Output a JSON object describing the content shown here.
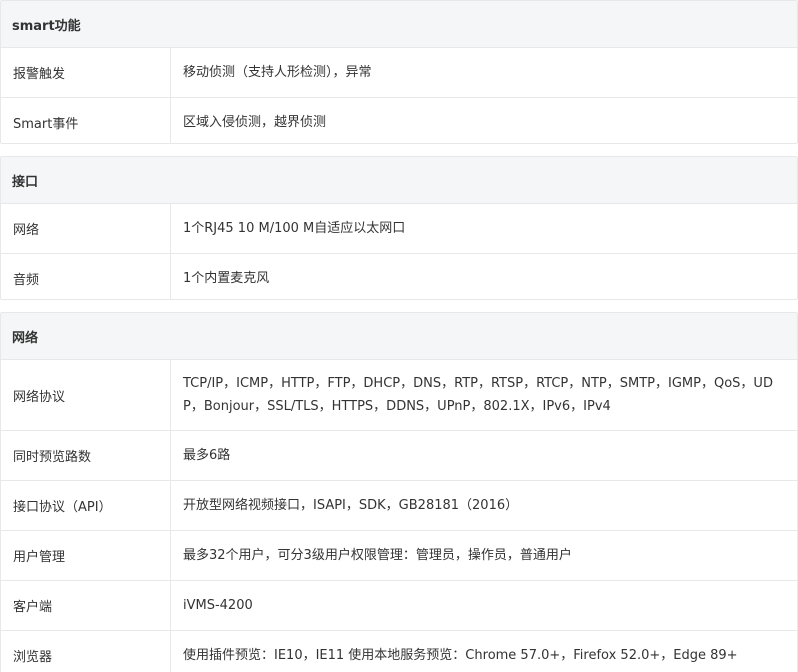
{
  "sections": [
    {
      "title": "smart功能",
      "rows": [
        {
          "label": "报警触发",
          "value": "移动侦测（支持人形检测），异常"
        },
        {
          "label": "Smart事件",
          "value": "区域入侵侦测，越界侦测"
        }
      ]
    },
    {
      "title": "接口",
      "rows": [
        {
          "label": "网络",
          "value": "1个RJ45 10 M/100 M自适应以太网口"
        },
        {
          "label": "音频",
          "value": "1个内置麦克风"
        }
      ]
    },
    {
      "title": "网络",
      "rows": [
        {
          "label": "网络协议",
          "value": "TCP/IP，ICMP，HTTP，FTP，DHCP，DNS，RTP，RTSP，RTCP，NTP，SMTP，IGMP，QoS，UDP，Bonjour，SSL/TLS，HTTPS，DDNS，UPnP，802.1X，IPv6，IPv4"
        },
        {
          "label": "同时预览路数",
          "value": "最多6路"
        },
        {
          "label": "接口协议（API）",
          "value": "开放型网络视频接口，ISAPI，SDK，GB28181（2016）"
        },
        {
          "label": "用户管理",
          "value": "最多32个用户，可分3级用户权限管理：管理员，操作员，普通用户"
        },
        {
          "label": "客户端",
          "value": "iVMS-4200"
        },
        {
          "label": "浏览器",
          "value": "使用插件预览：IE10，IE11 使用本地服务预览：Chrome 57.0+，Firefox 52.0+，Edge 89+"
        }
      ]
    }
  ]
}
